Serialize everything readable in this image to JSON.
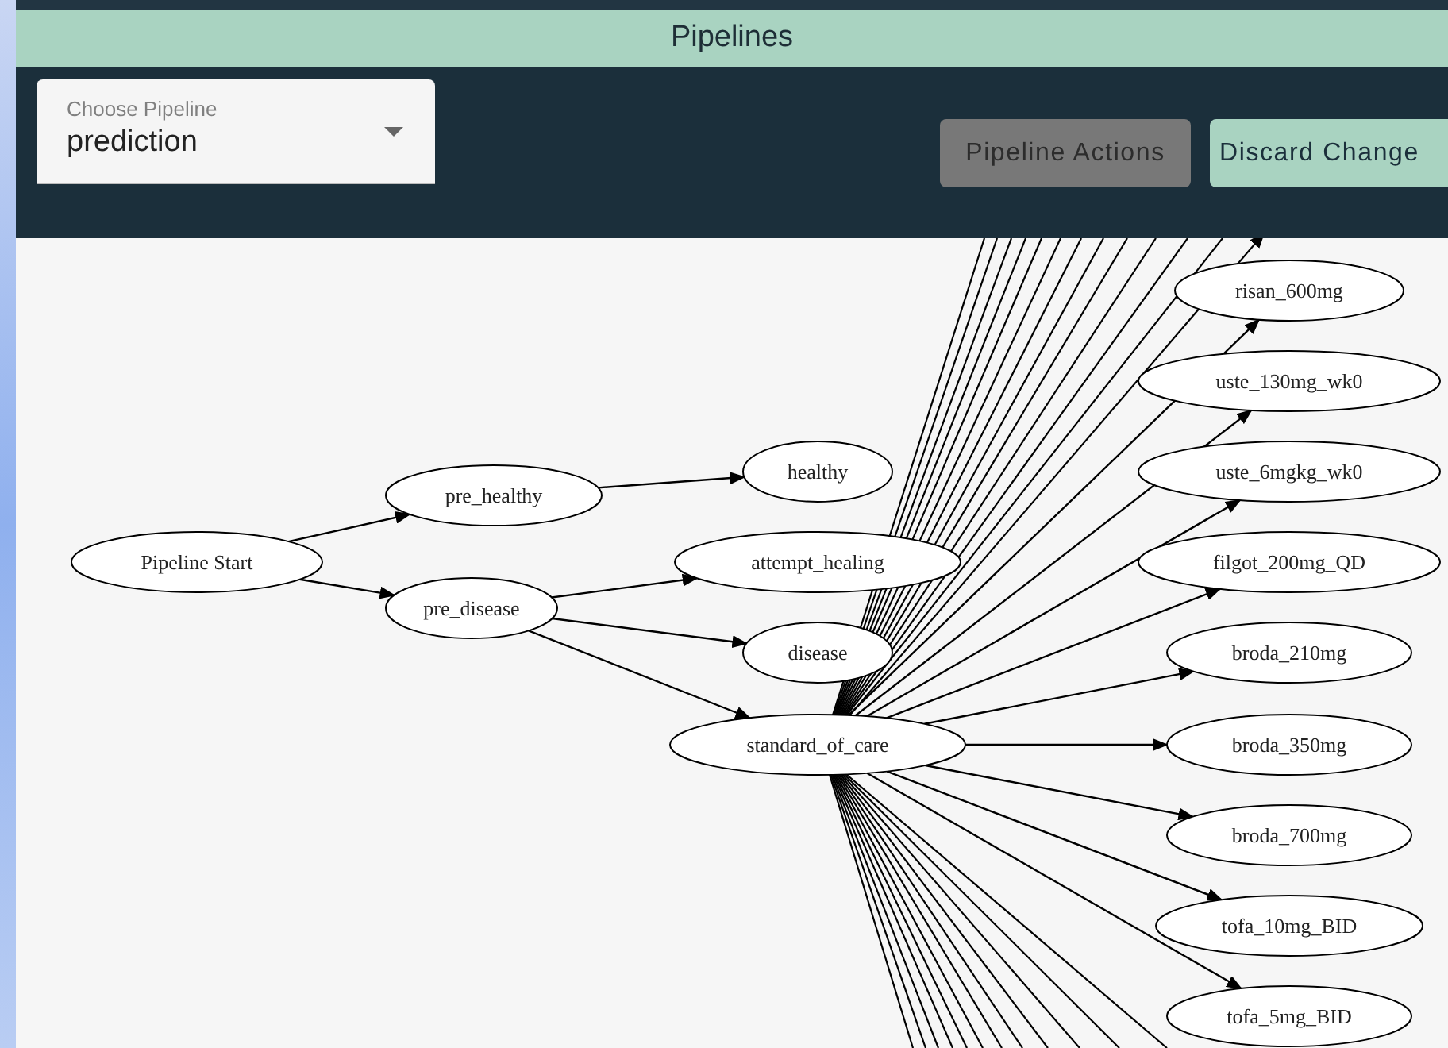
{
  "window": {
    "title": "Pipelines"
  },
  "pipeline_select": {
    "label": "Choose Pipeline",
    "value": "prediction"
  },
  "buttons": [
    {
      "label": "Pipeline Actions",
      "disabled": true
    },
    {
      "label": "Discard Change",
      "disabled": false
    }
  ],
  "graph": {
    "nodes": [
      {
        "label": "Pipeline Start",
        "children": [
          {
            "label": "pre_healthy",
            "children": [
              {
                "label": "healthy"
              }
            ]
          },
          {
            "label": "pre_disease",
            "children": [
              {
                "label": "attempt_healing"
              },
              {
                "label": "disease"
              },
              {
                "label": "standard_of_care",
                "children": [
                  {
                    "label": "risan_600mg"
                  },
                  {
                    "label": "uste_130mg_wk0"
                  },
                  {
                    "label": "uste_6mgkg_wk0"
                  },
                  {
                    "label": "filgot_200mg_QD"
                  },
                  {
                    "label": "broda_210mg"
                  },
                  {
                    "label": "broda_350mg"
                  },
                  {
                    "label": "broda_700mg"
                  },
                  {
                    "label": "tofa_10mg_BID"
                  },
                  {
                    "label": "tofa_5mg_BID"
                  }
                ]
              }
            ]
          }
        ]
      }
    ]
  }
}
